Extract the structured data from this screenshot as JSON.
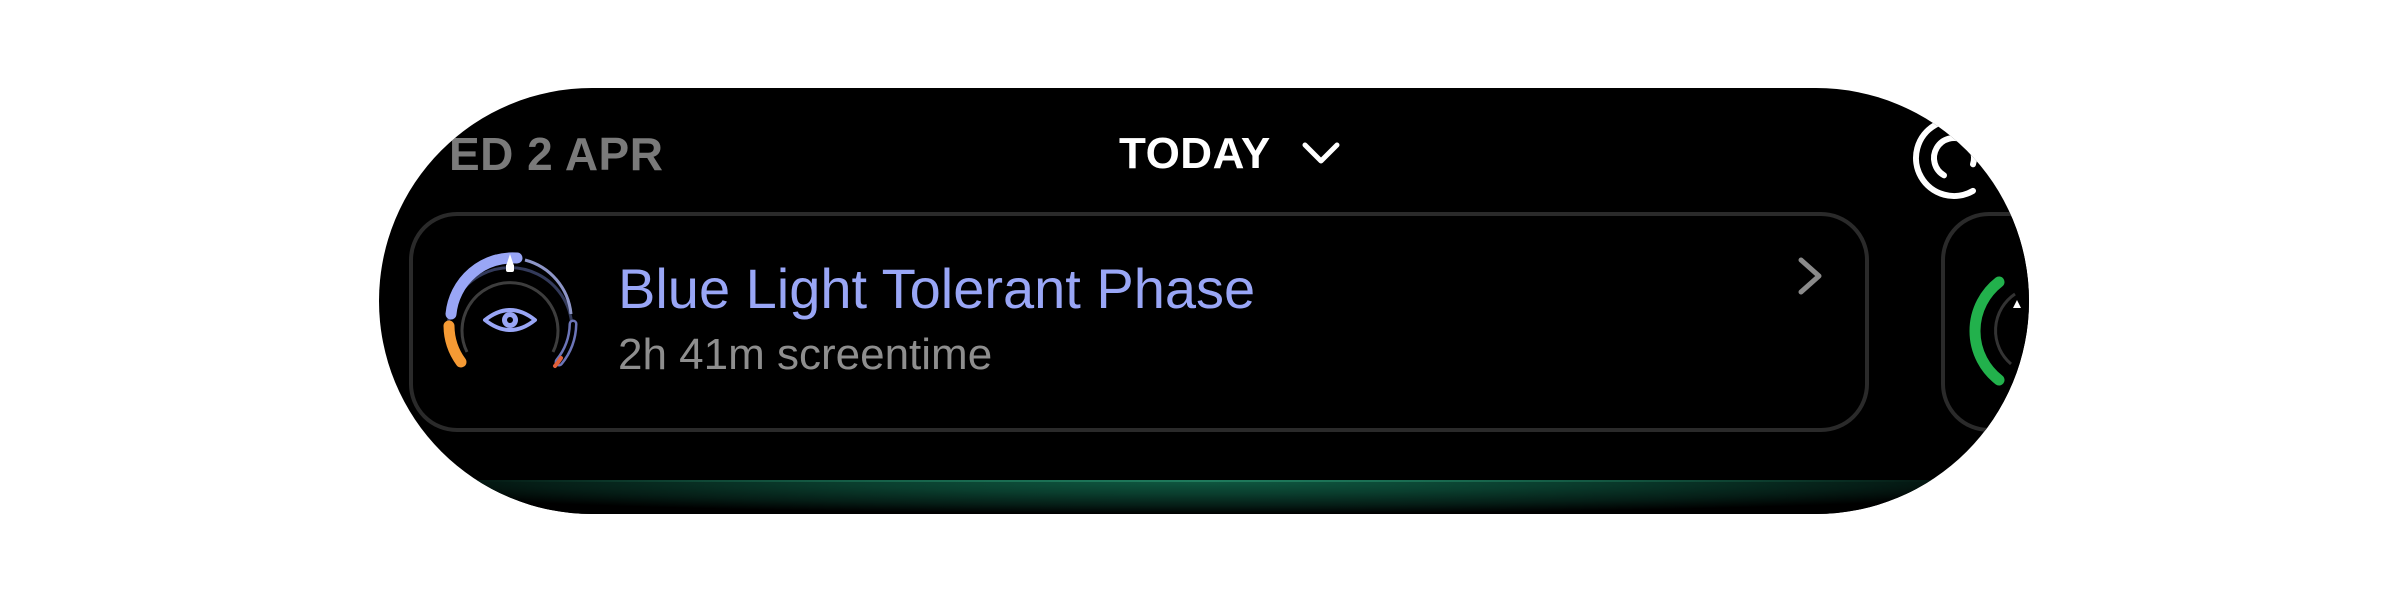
{
  "header": {
    "previous_date_label": "ED 2 APR",
    "current_date_label": "TODAY"
  },
  "phase_card": {
    "title": "Blue Light Tolerant Phase",
    "subtitle": "2h 41m screentime",
    "icon": "eye-icon"
  },
  "colors": {
    "phase_accent": "#99a6f6",
    "sunrise_orange": "#f59a34",
    "next_card_green": "#22b14c",
    "background": "#000000",
    "card_border": "#2a2a2a",
    "bottom_glow": "#0f5a42"
  }
}
